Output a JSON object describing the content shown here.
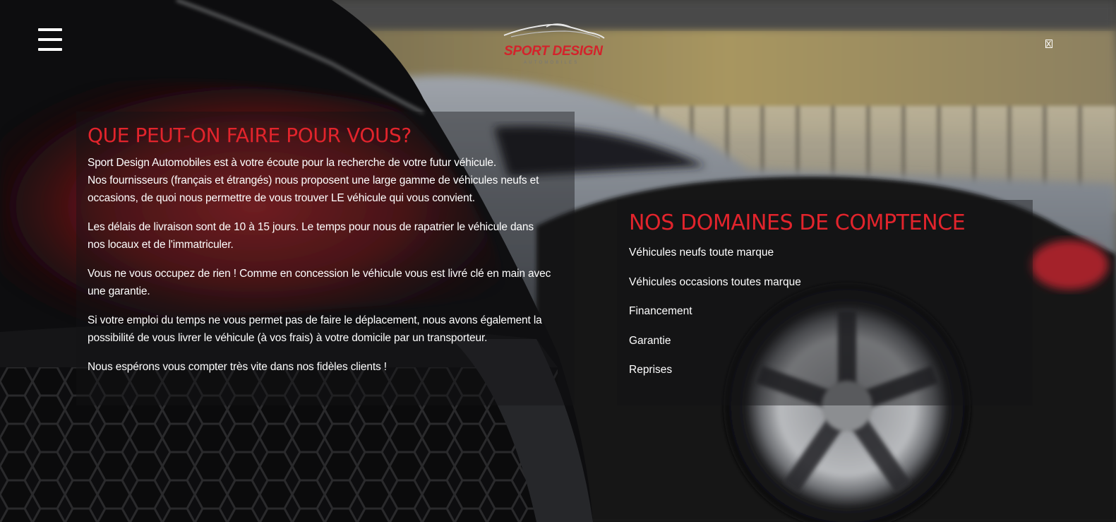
{
  "header": {
    "logo_title": "SPORT DESIGN",
    "logo_subtitle": "AUTOMOBILES",
    "menu_icon": "hamburger-menu-icon",
    "close_icon": "close-icon"
  },
  "about": {
    "title": "QUE PEUT-ON FAIRE POUR VOUS?",
    "paragraphs": [
      [
        "Sport Design Automobiles est à votre écoute pour la recherche de votre futur véhicule.",
        "Nos fournisseurs (français et étrangés) nous proposent une large gamme de véhicules neufs et",
        "occasions, de quoi nous permettre de vous trouver LE véhicule qui vous convient."
      ],
      [
        "Les délais de livraison sont de 10 à 15 jours. Le temps pour nous de rapatrier le véhicule dans",
        "nos locaux et de l'immatriculer."
      ],
      [
        "Vous ne vous occupez de rien ! Comme en concession le véhicule vous est livré clé en main avec",
        "une garantie."
      ],
      [
        "Si votre emploi du temps ne vous permet pas de faire le déplacement, nous avons également la",
        "possibilité de vous livrer le véhicule (à vos frais) à votre domicile par un transporteur."
      ],
      [
        "Nous espérons vous compter très vite dans nos fidèles clients !"
      ]
    ]
  },
  "domains": {
    "title": "NOS DOMAINES DE COMPTENCE",
    "items": [
      "Véhicules neufs toute marque",
      "Véhicules occasions toutes marque",
      "Financement",
      "Garantie",
      "Reprises"
    ]
  },
  "colors": {
    "accent_red": "#e2242c",
    "text": "#ffffff",
    "panel_bg": "rgba(18,18,22,0.42)"
  }
}
